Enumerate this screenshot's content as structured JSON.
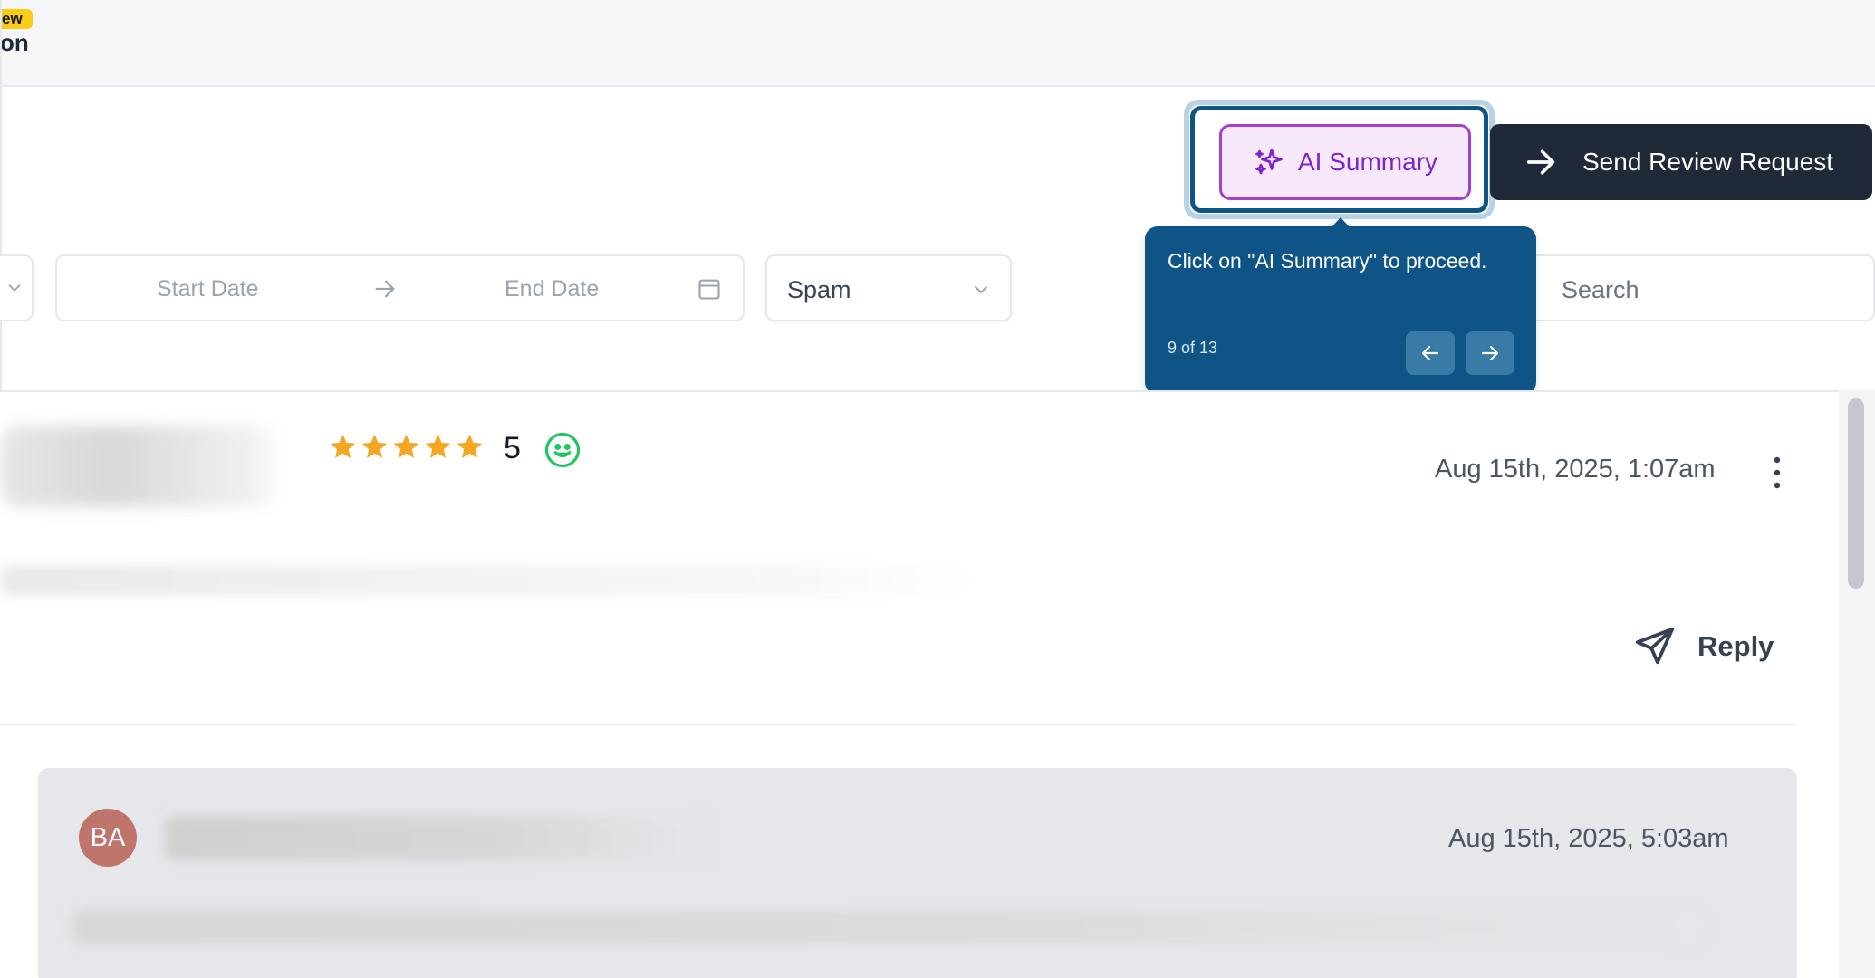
{
  "topbar": {
    "badge_label": "ew",
    "nav_fragment": "on"
  },
  "header": {
    "ai_summary_label": "AI Summary",
    "send_review_label": "Send Review Request"
  },
  "filters": {
    "start_date_placeholder": "Start Date",
    "end_date_placeholder": "End Date",
    "spam_value": "Spam",
    "search_placeholder": "Search"
  },
  "tooltip": {
    "text": "Click on \"AI Summary\" to proceed.",
    "step": "9 of 13"
  },
  "review": {
    "rating": "5",
    "date": "Aug 15th, 2025, 1:07am",
    "reply_label": "Reply",
    "star_color": "#f5a623",
    "sentiment_icon": "smile-icon"
  },
  "reply_card": {
    "avatar_initials": "BA",
    "date": "Aug 15th, 2025, 5:03am"
  },
  "colors": {
    "tooltip_bg": "#0e5486",
    "ai_accent": "#a340d2",
    "primary_dark": "#1f2937"
  }
}
